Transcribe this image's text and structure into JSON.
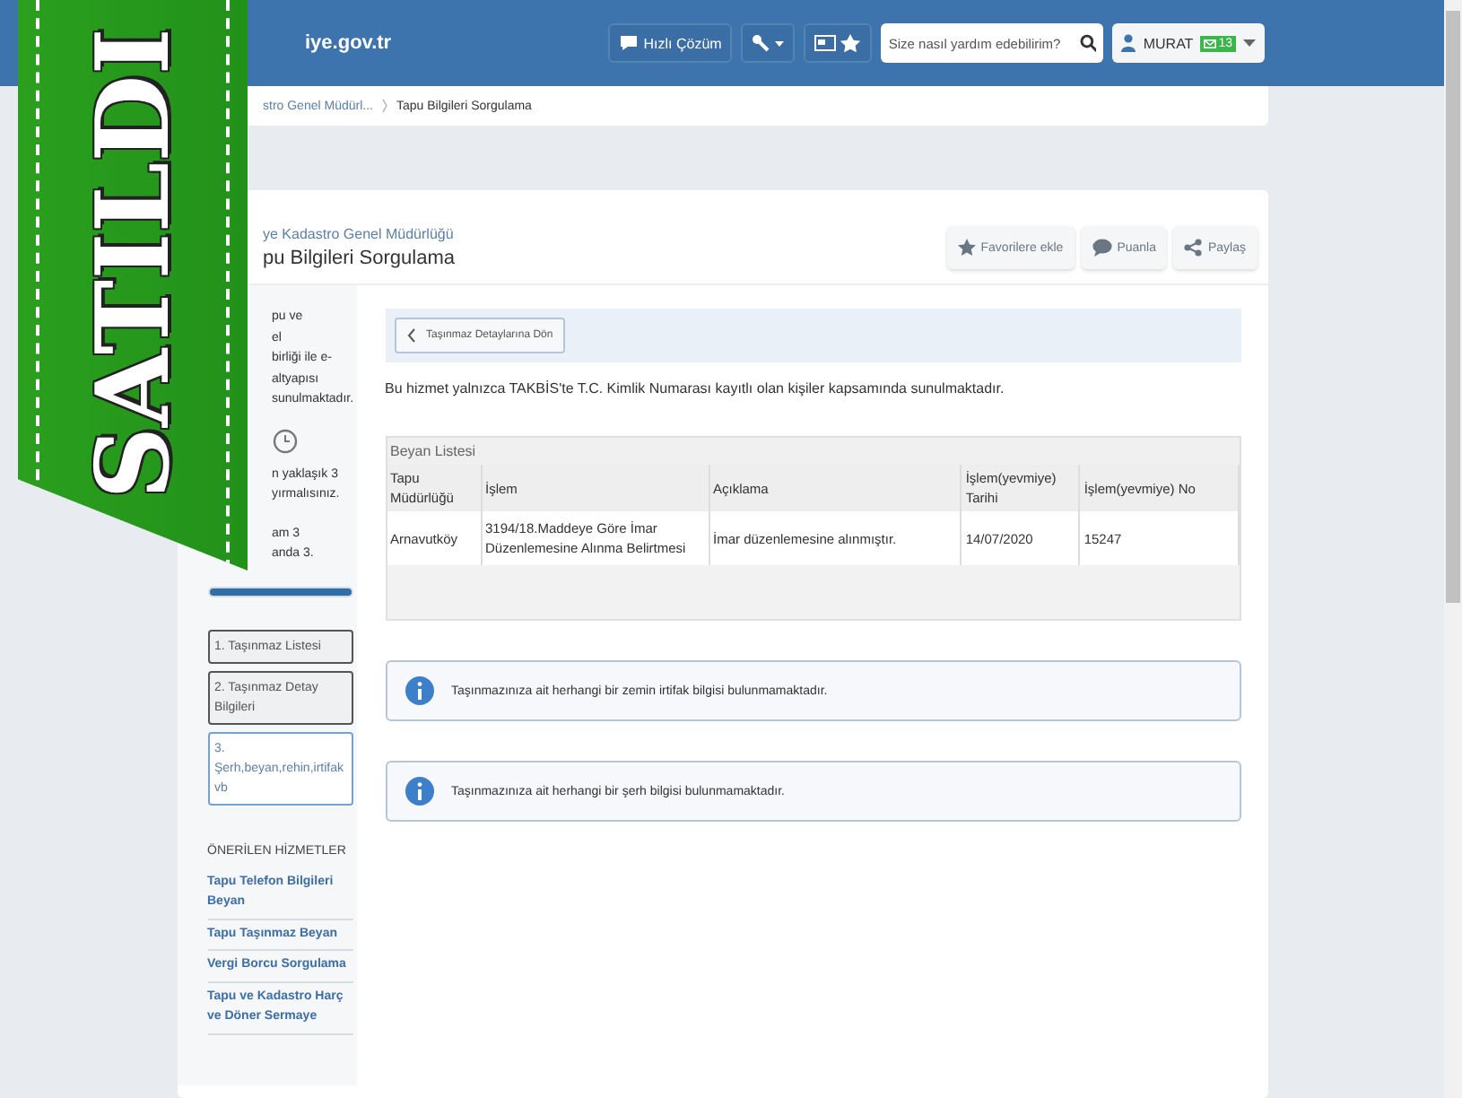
{
  "banner": {
    "text": "SATILDI"
  },
  "header": {
    "logo": "iye.gov.tr",
    "quick_help": "Hızlı Çözüm",
    "search": {
      "placeholder": "Size nasıl yardım edebilirim?"
    },
    "user": {
      "name": "MURAT",
      "badge": "13"
    }
  },
  "breadcrumb": [
    "stro Genel Müdürl...",
    "Tapu Bilgileri Sorgulama"
  ],
  "page": {
    "institution": "ye Kadastro Genel Müdürlüğü",
    "title": "pu Bilgileri Sorgulama",
    "actions": [
      {
        "kind": "star",
        "label": "Favorilere ekle"
      },
      {
        "kind": "comment",
        "label": "Puanla"
      },
      {
        "kind": "share",
        "label": "Paylaş"
      }
    ]
  },
  "sidebar": {
    "intro_lines": [
      "pu ve",
      "el",
      "birliği ile e-",
      "altyapısı",
      "sunulmaktadır."
    ],
    "note_lines": [
      "n yaklaşık 3",
      "yırmalısınız."
    ],
    "step_lines": [
      "am 3",
      "anda 3."
    ],
    "progress": {
      "level": 1
    },
    "steps": [
      {
        "label": "1. Taşınmaz Listesi",
        "selected": false
      },
      {
        "label": "2. Taşınmaz Detay Bilgileri",
        "selected": false
      },
      {
        "label": "3. Şerh,beyan,rehin,irtifak vb",
        "selected": true
      }
    ],
    "recommended": {
      "title": "ÖNERİLEN HİZMETLER",
      "links": [
        "Tapu Telefon Bilgileri Beyan",
        "Tapu Taşınmaz Beyan",
        "Vergi Borcu Sorgulama",
        "Tapu ve Kadastro Harç ve Döner Sermaye"
      ]
    }
  },
  "main": {
    "back_button": "Taşınmaz Detaylarına Dön",
    "notice": "Bu hizmet yalnızca TAKBİS'te T.C. Kimlik Numarası kayıtlı olan kişiler kapsamında sunulmaktadır.",
    "table": {
      "title": "Beyan Listesi",
      "columns": [
        "Tapu Müdürlüğü",
        "İşlem",
        "Açıklama",
        "İşlem(yevmiye) Tarihi",
        "İşlem(yevmiye) No"
      ],
      "rows": [
        [
          "Arnavutköy",
          "3194/18.Maddeye Göre İmar Düzenlemesine Alınma Belirtmesi",
          "İmar düzenlemesine alınmıştır.",
          "14/07/2020",
          "15247"
        ]
      ]
    },
    "alerts": [
      "Taşınmazınıza ait herhangi bir zemin irtifak bilgisi bulunmamaktadır.",
      "Taşınmazınıza ait herhangi bir şerh bilgisi bulunmamaktadır."
    ]
  }
}
